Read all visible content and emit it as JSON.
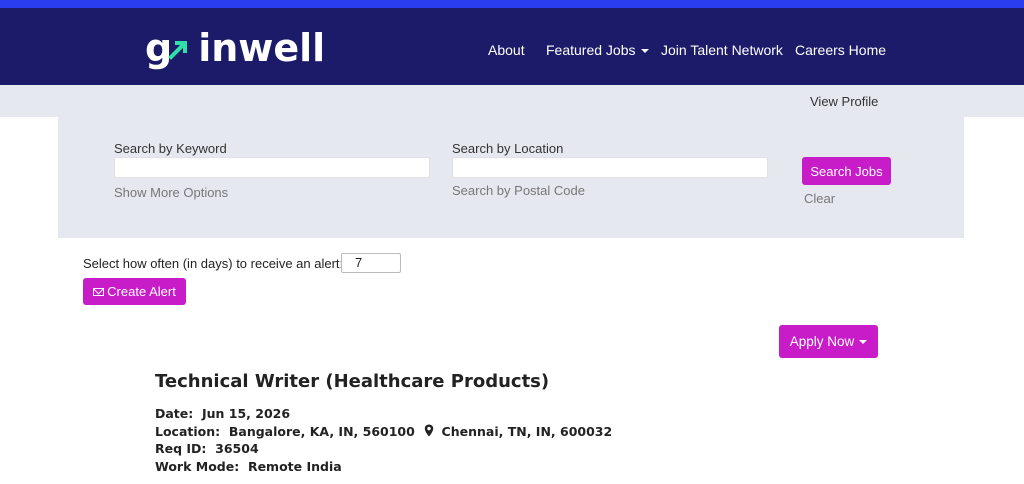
{
  "brand": {
    "logo_text": "gainwell",
    "logo_prefix": "g",
    "logo_suffix": "inwell"
  },
  "nav": {
    "about": "About",
    "featured_jobs": "Featured Jobs",
    "join_talent": "Join Talent Network",
    "careers_home": "Careers Home"
  },
  "subbar": {
    "view_profile": "View Profile"
  },
  "search": {
    "keyword_label": "Search by Keyword",
    "keyword_value": "",
    "location_label": "Search by Location",
    "location_value": "",
    "more_options": "Show More Options",
    "postal_code": "Search by Postal Code",
    "search_button": "Search Jobs",
    "clear": "Clear"
  },
  "alert": {
    "prompt": "Select how often (in days) to receive an alert:",
    "days_value": "7",
    "create_button": "Create Alert"
  },
  "apply": {
    "button": "Apply Now"
  },
  "job": {
    "title": "Technical Writer (Healthcare Products)",
    "date_label": "Date:",
    "date_value": "Jun 15, 2026",
    "location_label": "Location:",
    "location_1": "Bangalore, KA, IN, 560100",
    "location_2": "Chennai, TN, IN, 600032",
    "req_label": "Req ID:",
    "req_value": "36504",
    "mode_label": "Work Mode:",
    "mode_value": "Remote India"
  },
  "icons": [
    "logo-arrow-icon",
    "caret-down-icon",
    "mail-icon",
    "map-pin-icon"
  ],
  "colors": {
    "header": "#1b1b6a",
    "accent": "#c81cc8",
    "panel": "#e6e8f0",
    "stripe": "#2a3ef0",
    "logo_arrow": "#2ee0a6"
  }
}
